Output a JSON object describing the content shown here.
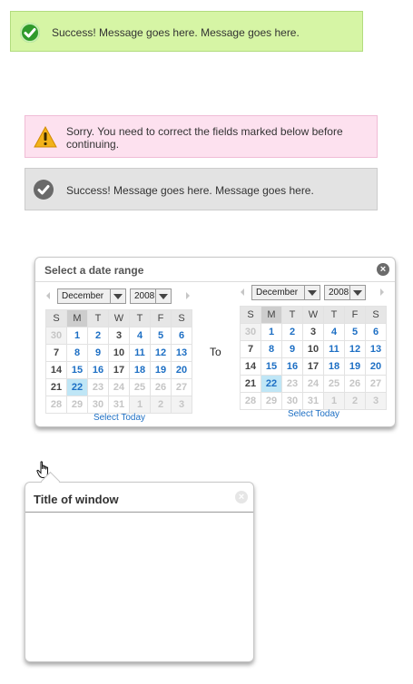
{
  "messages": {
    "success": "Success! Message goes here. Message goes here.",
    "error": "Sorry. You need to correct the fields marked below before continuing.",
    "neutral": "Success! Message goes here. Message goes here."
  },
  "date_range": {
    "title": "Select a date range",
    "to_label": "To",
    "close_icon": "close-icon",
    "calendars": [
      {
        "month": "December",
        "year": "2008",
        "select_today": "Select Today"
      },
      {
        "month": "December",
        "year": "2008",
        "select_today": "Select Today"
      }
    ],
    "weekday_headers": [
      "S",
      "M",
      "T",
      "W",
      "T",
      "F",
      "S"
    ],
    "weeks": [
      [
        "30",
        "1",
        "2",
        "3",
        "4",
        "5",
        "6"
      ],
      [
        "7",
        "8",
        "9",
        "10",
        "11",
        "12",
        "13"
      ],
      [
        "14",
        "15",
        "16",
        "17",
        "18",
        "19",
        "20"
      ],
      [
        "21",
        "22",
        "23",
        "24",
        "25",
        "26",
        "27"
      ],
      [
        "28",
        "29",
        "30",
        "31",
        "1",
        "2",
        "3"
      ]
    ]
  },
  "window": {
    "title": "Title of window"
  },
  "colors": {
    "success_bg": "#d6f5a5",
    "error_bg": "#fde1ef",
    "neutral_bg": "#e3e3e3",
    "link_blue": "#1d6fc4",
    "today_bg": "#bfe6f6"
  }
}
